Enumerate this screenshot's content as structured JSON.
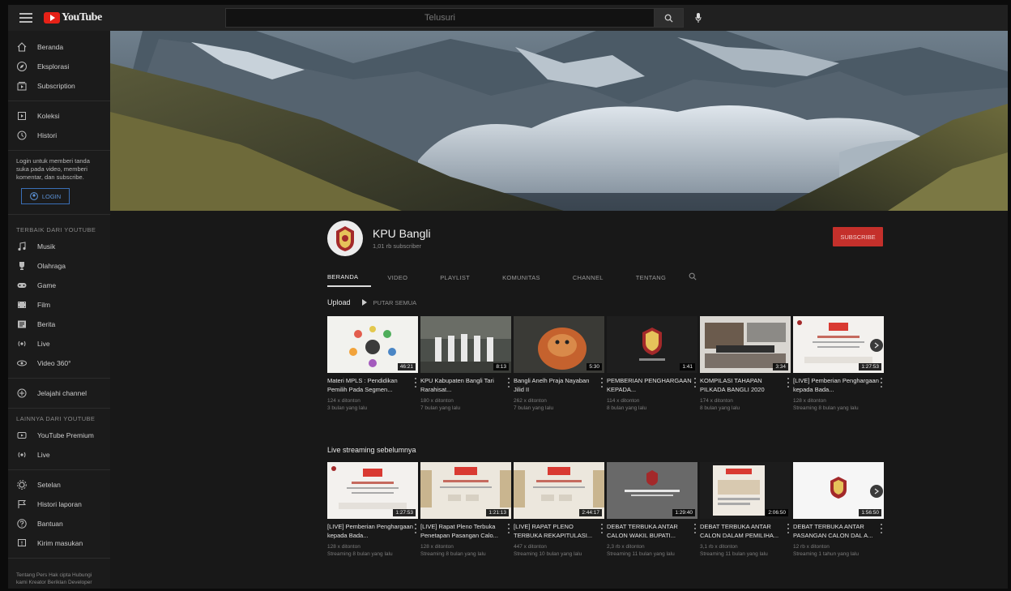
{
  "topbar": {
    "logo_text": "YouTube",
    "search_placeholder": "Telusuri"
  },
  "sidebar": {
    "primary": [
      {
        "label": "Beranda",
        "icon": "home-icon"
      },
      {
        "label": "Eksplorasi",
        "icon": "compass-icon"
      },
      {
        "label": "Subscription",
        "icon": "subscriptions-icon"
      }
    ],
    "secondary": [
      {
        "label": "Koleksi",
        "icon": "library-icon"
      },
      {
        "label": "Histori",
        "icon": "history-icon"
      }
    ],
    "login_note": "Login untuk memberi tanda suka pada video, memberi komentar, dan subscribe.",
    "login_label": "LOGIN",
    "best_heading": "TERBAIK DARI YOUTUBE",
    "best": [
      {
        "label": "Musik",
        "icon": "music-icon"
      },
      {
        "label": "Olahraga",
        "icon": "trophy-icon"
      },
      {
        "label": "Game",
        "icon": "gamepad-icon"
      },
      {
        "label": "Film",
        "icon": "film-icon"
      },
      {
        "label": "Berita",
        "icon": "news-icon"
      },
      {
        "label": "Live",
        "icon": "live-icon"
      },
      {
        "label": "Video 360°",
        "icon": "video360-icon"
      }
    ],
    "browse_label": "Jelajahi channel",
    "more_heading": "LAINNYA DARI YOUTUBE",
    "more": [
      {
        "label": "YouTube Premium",
        "icon": "youtube-premium-icon"
      },
      {
        "label": "Live",
        "icon": "live-icon"
      }
    ],
    "settings": [
      {
        "label": "Setelan",
        "icon": "gear-icon"
      },
      {
        "label": "Histori laporan",
        "icon": "flag-icon"
      },
      {
        "label": "Bantuan",
        "icon": "help-icon"
      },
      {
        "label": "Kirim masukan",
        "icon": "feedback-icon"
      }
    ],
    "footer": "Tentang  Pers  Hak cipta  Hubungi kami  Kreator  Beriklan  Developer"
  },
  "channel": {
    "name": "KPU Bangli",
    "subscribers": "1,01 rb subscriber",
    "subscribe_label": "SUBSCRIBE",
    "tabs": [
      "BERANDA",
      "VIDEO",
      "PLAYLIST",
      "KOMUNITAS",
      "CHANNEL",
      "TENTANG"
    ],
    "active_tab": 0
  },
  "uploads": {
    "title": "Upload",
    "play_all": "PUTAR SEMUA",
    "videos": [
      {
        "title": "Materi MPLS : Pendidikan Pemilih Pada Segmen...",
        "views": "124 x ditonton",
        "age": "3 bulan yang lalu",
        "duration": "46:21",
        "thumb": "diagram"
      },
      {
        "title": "KPU Kabupaten Bangli Tari Rarahisat...",
        "views": "180 x ditonton",
        "age": "7 bulan yang lalu",
        "duration": "8:13",
        "thumb": "group"
      },
      {
        "title": "Bangli Anelh Praja Nayaban Jilid II",
        "views": "262 x ditonton",
        "age": "7 bulan yang lalu",
        "duration": "5:30",
        "thumb": "barong"
      },
      {
        "title": "PEMBERIAN PENGHARGAAN KEPADA...",
        "views": "114 x ditonton",
        "age": "8 bulan yang lalu",
        "duration": "1:41",
        "thumb": "logo"
      },
      {
        "title": "KOMPILASI TAHAPAN PILKADA BANGLI 2020",
        "views": "174 x ditonton",
        "age": "8 bulan yang lalu",
        "duration": "3:34",
        "thumb": "pilkada"
      },
      {
        "title": "[LIVE] Pemberian Penghargaan kepada Bada...",
        "views": "128 x ditonton",
        "age": "Streaming 8 bulan yang lalu",
        "duration": "1:27:53",
        "thumb": "award"
      }
    ]
  },
  "live": {
    "title": "Live streaming sebelumnya",
    "videos": [
      {
        "title": "[LIVE] Pemberian Penghargaan kepada Bada...",
        "views": "128 x ditonton",
        "age": "Streaming 8 bulan yang lalu",
        "duration": "1:27:53",
        "thumb": "award"
      },
      {
        "title": "[LIVE] Rapat Pleno Terbuka Penetapan Pasangan Calo...",
        "views": "128 x ditonton",
        "age": "Streaming 8 bulan yang lalu",
        "duration": "1:21:13",
        "thumb": "pleno"
      },
      {
        "title": "[LIVE] RAPAT PLENO TERBUKA REKAPITULASI...",
        "views": "447 x ditonton",
        "age": "Streaming 10 bulan yang lalu",
        "duration": "2:44:17",
        "thumb": "pleno"
      },
      {
        "title": "DEBAT TERBUKA ANTAR CALON WAKIL BUPATI...",
        "views": "2,3 rb x ditonton",
        "age": "Streaming 11 bulan yang lalu",
        "duration": "1:29:40",
        "thumb": "debate"
      },
      {
        "title": "DEBAT TERBUKA ANTAR CALON DALAM PEMILIHA...",
        "views": "3,1 rb x ditonton",
        "age": "Streaming 11 bulan yang lalu",
        "duration": "2:06:50",
        "thumb": "poster"
      },
      {
        "title": "DEBAT TERBUKA ANTAR PASANGAN CALON DAL A...",
        "views": "12 rb x ditonton",
        "age": "Streaming 1 tahun yang lalu",
        "duration": "1:56:50",
        "thumb": "kpu"
      }
    ]
  },
  "colors": {
    "accent_red": "#c4302b",
    "link_blue": "#3a6fb7",
    "page_bg": "#181818"
  }
}
